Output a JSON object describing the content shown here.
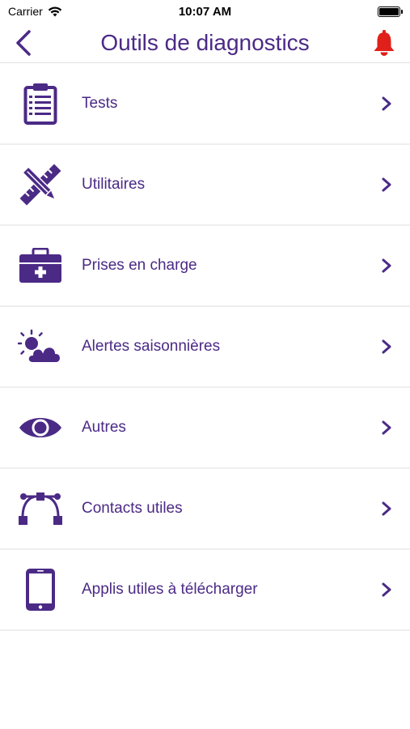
{
  "status_bar": {
    "carrier": "Carrier",
    "time": "10:07 AM"
  },
  "nav": {
    "title": "Outils de diagnostics"
  },
  "menu": {
    "items": [
      {
        "label": "Tests",
        "icon": "clipboard-icon"
      },
      {
        "label": "Utilitaires",
        "icon": "pencil-ruler-icon"
      },
      {
        "label": "Prises en charge",
        "icon": "medical-kit-icon"
      },
      {
        "label": "Alertes saisonnières",
        "icon": "sun-cloud-icon"
      },
      {
        "label": "Autres",
        "icon": "eye-icon"
      },
      {
        "label": "Contacts utiles",
        "icon": "network-icon"
      },
      {
        "label": "Applis utiles à télécharger",
        "icon": "smartphone-icon"
      }
    ]
  },
  "colors": {
    "primary": "#4b2a86",
    "bell": "#e0201a",
    "divider": "#eeeeee"
  }
}
